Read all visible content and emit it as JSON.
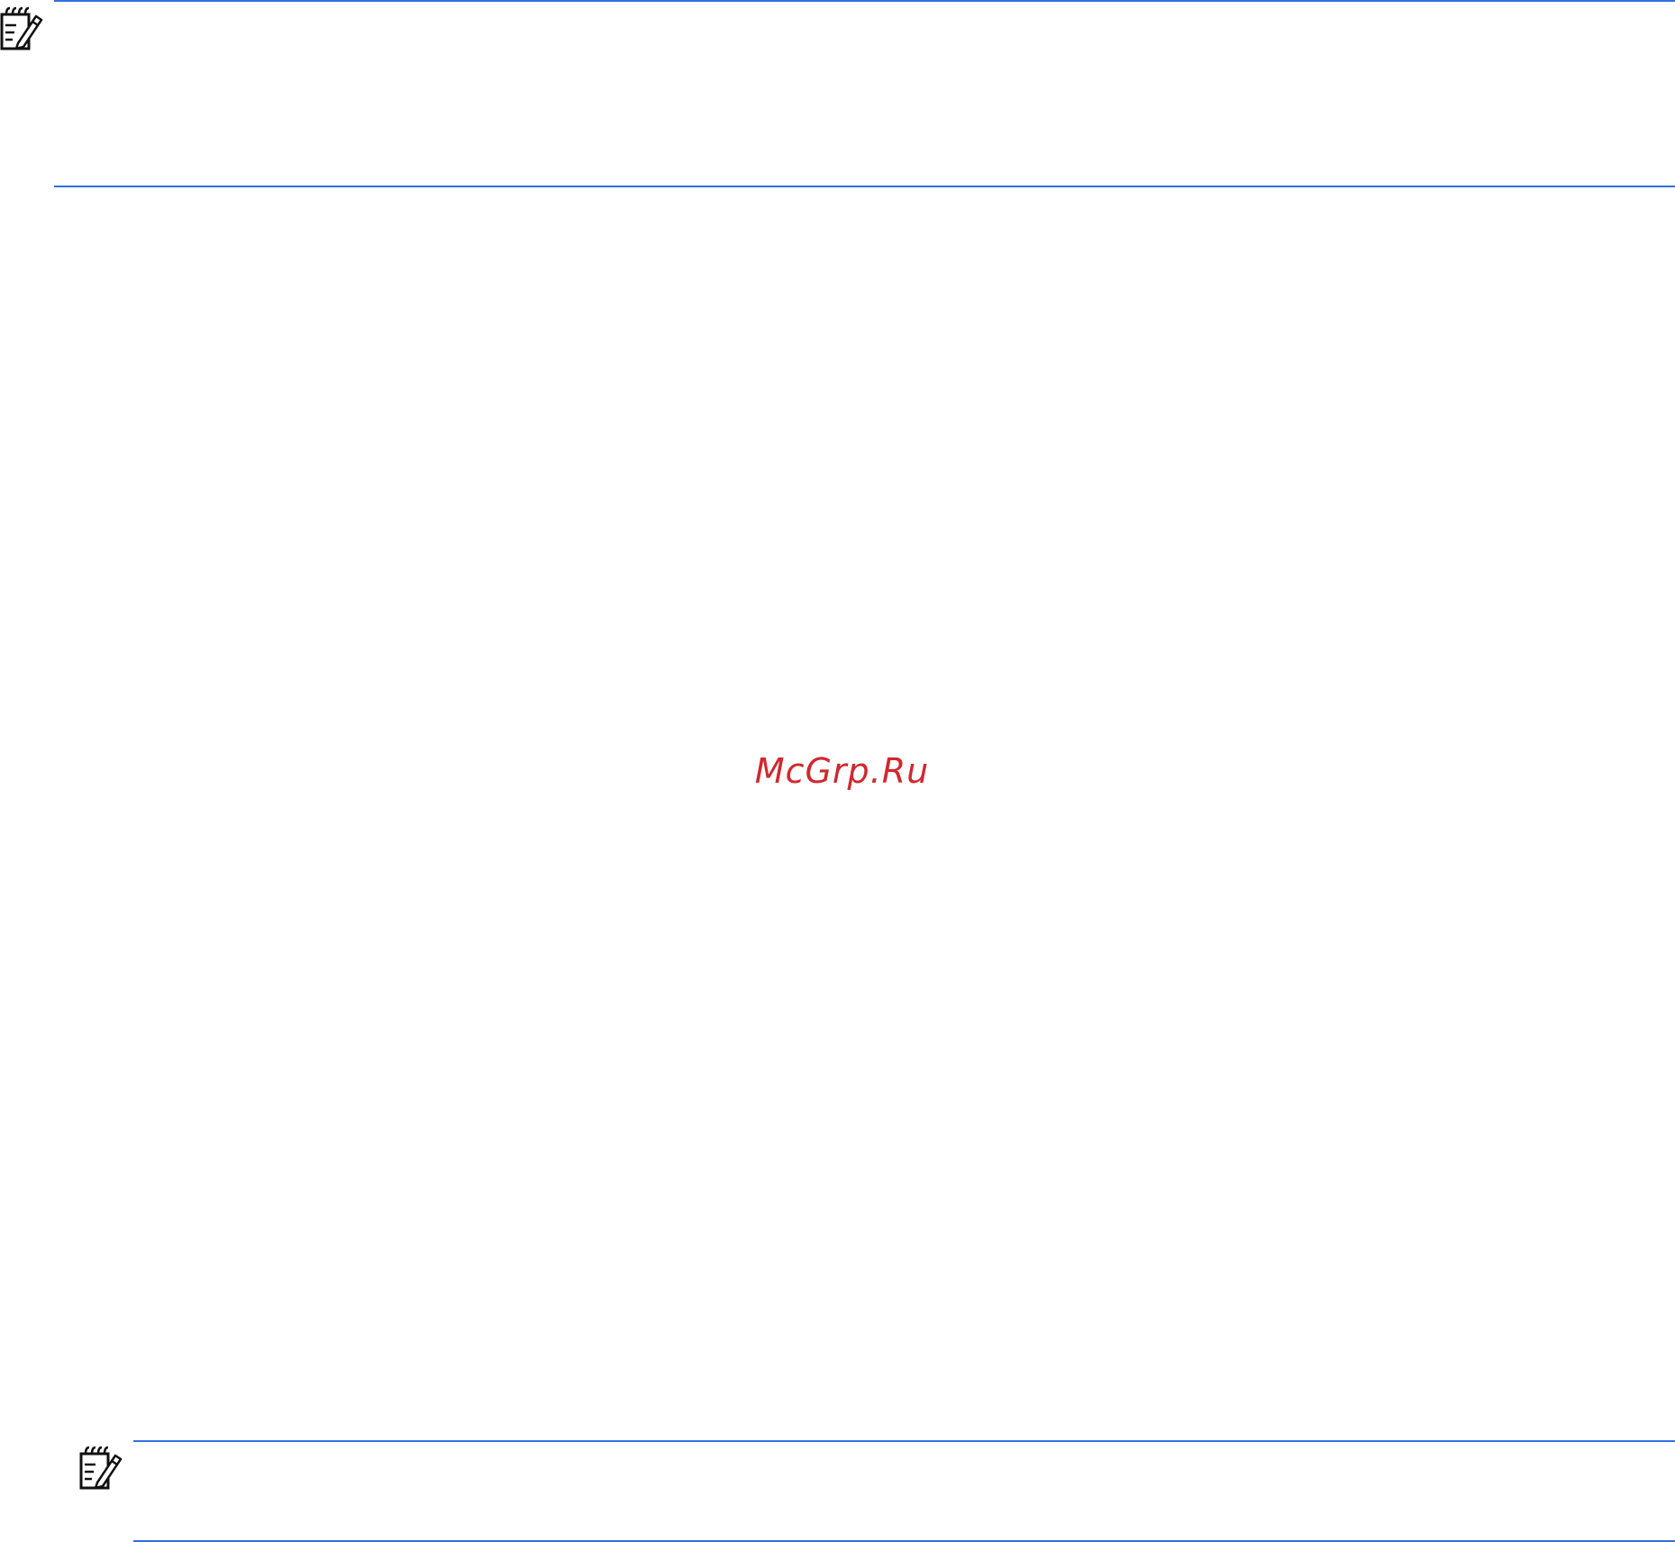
{
  "colors": {
    "rule": "#2f6fe0",
    "watermark": "#d0282e"
  },
  "notes": [
    {
      "icon": "note-pencil-icon"
    },
    {
      "icon": "note-pencil-icon"
    }
  ],
  "watermark": {
    "text": "McGrp.Ru"
  }
}
